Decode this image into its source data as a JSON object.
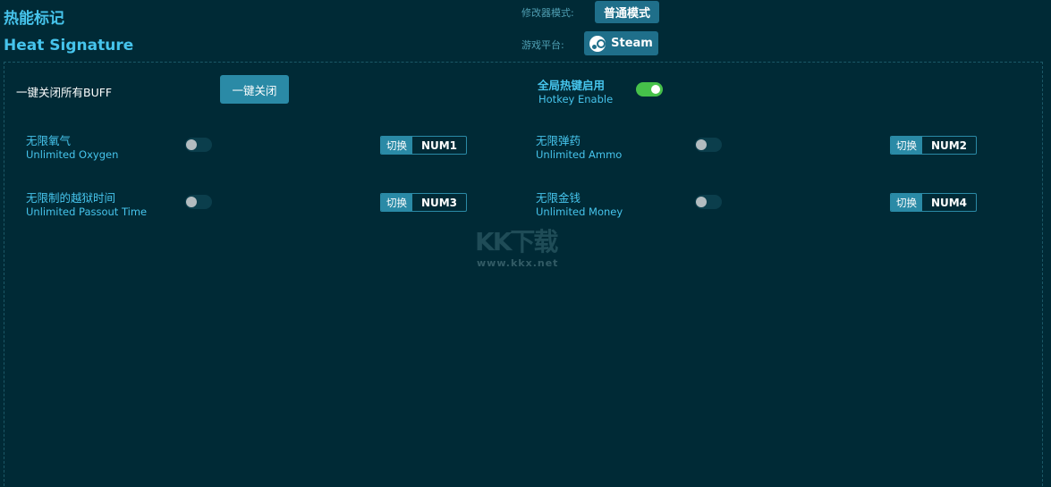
{
  "header": {
    "title_cn": "热能标记",
    "title_en": "Heat Signature",
    "mode_label": "修改器模式:",
    "mode_value": "普通模式",
    "platform_label": "游戏平台:",
    "platform_value": "Steam"
  },
  "controls": {
    "close_all_label": "一键关闭所有BUFF",
    "close_all_button": "一键关闭",
    "hotkey_enable_cn": "全局热键启用",
    "hotkey_enable_en": "Hotkey Enable",
    "hotkey_enabled": true
  },
  "options": [
    {
      "name_cn": "无限氧气",
      "name_en": "Unlimited Oxygen",
      "enabled": false,
      "switch_label": "切换",
      "key": "NUM1"
    },
    {
      "name_cn": "无限弹药",
      "name_en": "Unlimited Ammo",
      "enabled": false,
      "switch_label": "切换",
      "key": "NUM2"
    },
    {
      "name_cn": "无限制的越狱时间",
      "name_en": "Unlimited Passout Time",
      "enabled": false,
      "switch_label": "切换",
      "key": "NUM3"
    },
    {
      "name_cn": "无限金钱",
      "name_en": "Unlimited Money",
      "enabled": false,
      "switch_label": "切换",
      "key": "NUM4"
    }
  ],
  "watermark": {
    "logo": "KK下载",
    "url": "www.kkx.net"
  },
  "colors": {
    "background": "#002a36",
    "accent": "#46c4ec",
    "button": "#2a8aa6",
    "toggle_on": "#46c14a"
  }
}
